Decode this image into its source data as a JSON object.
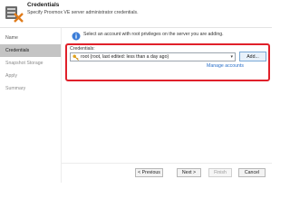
{
  "header": {
    "title": "Credentials",
    "subtitle": "Specify Proxmox VE server administrator credentials."
  },
  "sidebar": {
    "items": [
      {
        "label": "Name"
      },
      {
        "label": "Credentials"
      },
      {
        "label": "Snapshot Storage"
      },
      {
        "label": "Apply"
      },
      {
        "label": "Summary"
      }
    ],
    "active_index": 1
  },
  "main": {
    "info_text": "Select an account with root privileges on the server you are adding.",
    "credentials": {
      "label": "Credentials:",
      "selected": "root (root, last edited: less than a day ago)",
      "add_label": "Add...",
      "manage_label": "Manage accounts"
    }
  },
  "footer": {
    "previous_label": "< Previous",
    "next_label": "Next >",
    "finish_label": "Finish",
    "cancel_label": "Cancel"
  },
  "colors": {
    "highlight_border": "#e0202a",
    "link": "#2a6fc9",
    "active_nav": "#c4c4c4"
  },
  "icons": {
    "header": "server-credentials-icon",
    "info": "info-icon",
    "credential": "key-icon"
  }
}
